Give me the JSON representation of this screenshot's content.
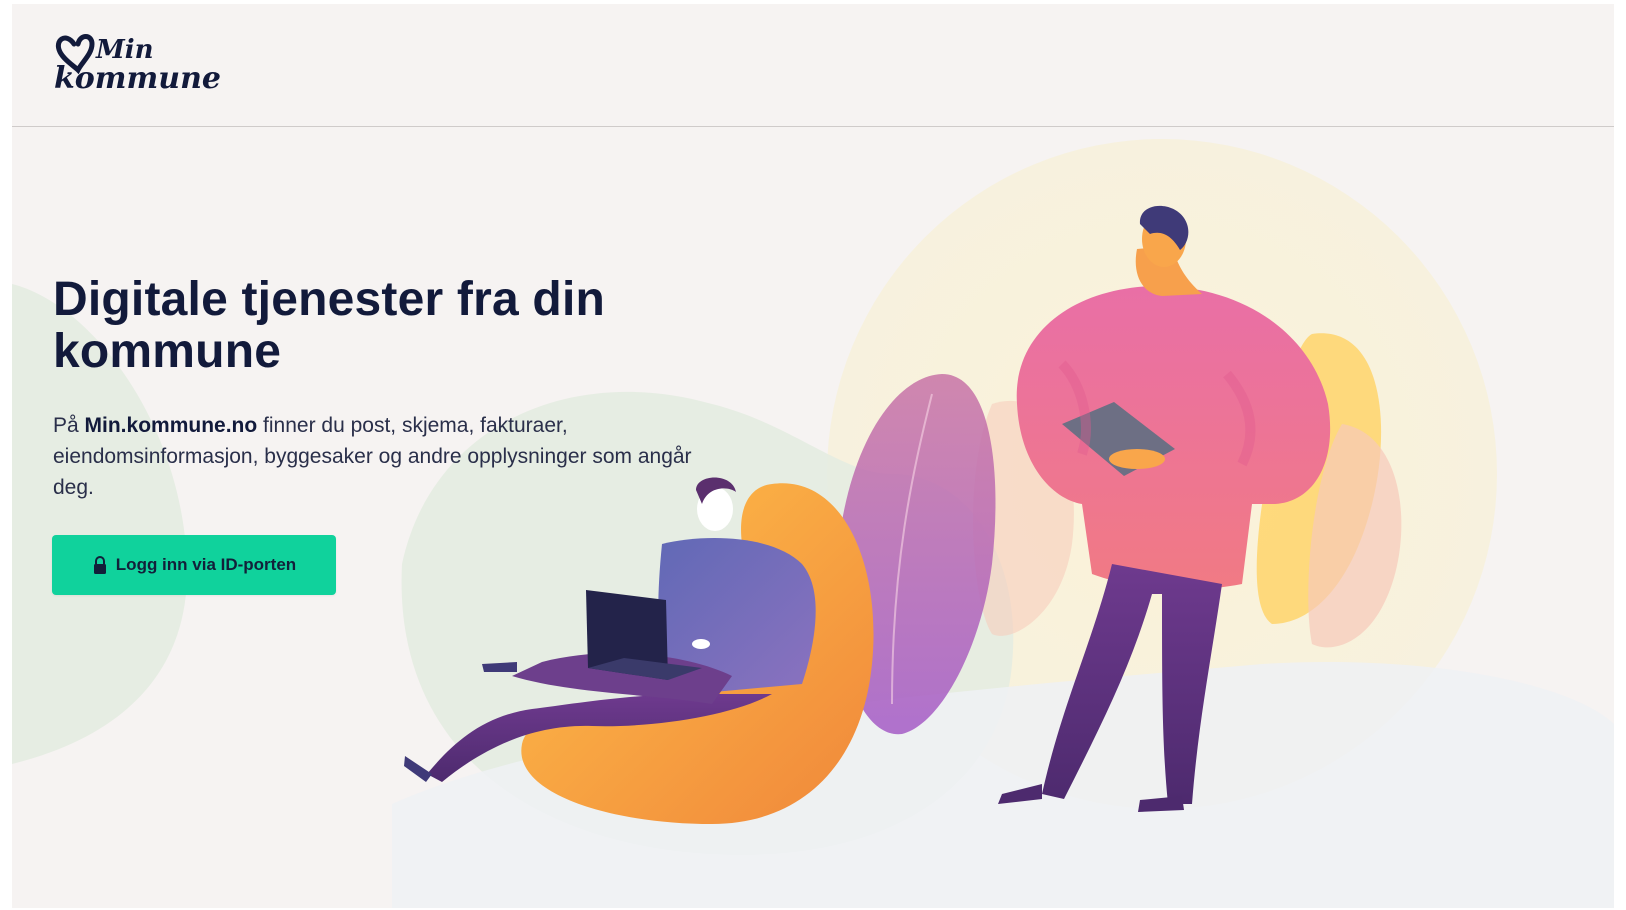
{
  "brand": {
    "logo_text_line1": "Min",
    "logo_text_line2": "kommune"
  },
  "hero": {
    "title": "Digitale tjenester fra din kommune",
    "text_prefix": "På ",
    "text_brand": "Min.kommune.no",
    "text_suffix": " finner du post, skjema, fakturaer, eiendomsinformasjon, byggesaker og andre opplysninger som angår deg."
  },
  "login": {
    "label": "Logg inn via ID-porten",
    "icon": "lock-icon"
  },
  "colors": {
    "accent": "#10d29c",
    "heading": "#121a3b",
    "background": "#f6f3f2"
  }
}
